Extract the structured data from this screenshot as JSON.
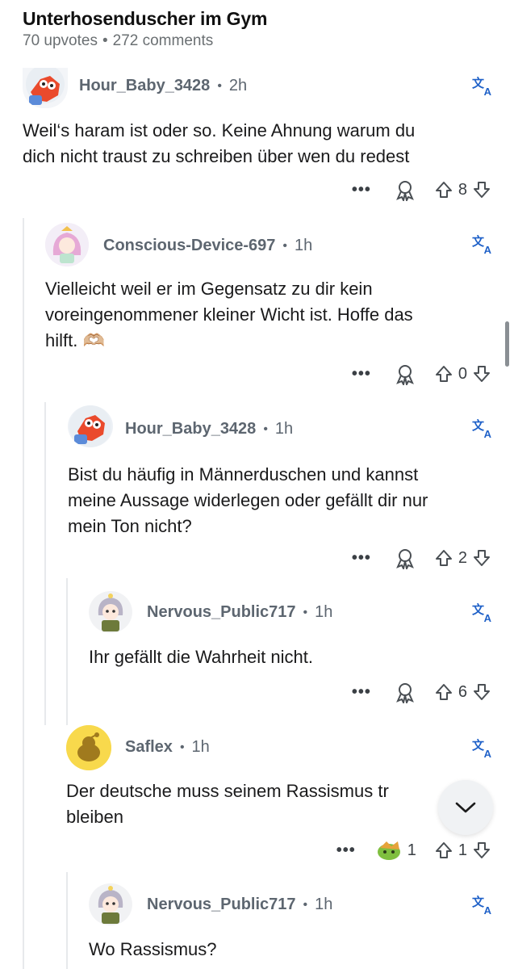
{
  "post": {
    "title": "Unterhosenduscher im Gym",
    "upvotes": "70 upvotes",
    "comments": "272 comments"
  },
  "comments": [
    {
      "username": "Hour_Baby_3428",
      "age": "2h",
      "text_lines": [
        "Weil‘s haram ist oder so. Keine Ahnung warum du",
        "dich nicht traust zu schreiben über wen du redest"
      ],
      "score": "8"
    },
    {
      "username": "Conscious-Device-697",
      "age": "1h",
      "text_lines": [
        "Vielleicht weil er im Gegensatz zu dir kein",
        "voreingenommener kleiner Wicht ist. Hoffe das",
        "hilft. 🫶🏼"
      ],
      "score": "0"
    },
    {
      "username": "Hour_Baby_3428",
      "age": "1h",
      "text_lines": [
        "Bist du häufig in Männerduschen und kannst",
        "meine Aussage widerlegen oder gefällt dir nur",
        "mein Ton nicht?"
      ],
      "score": "2"
    },
    {
      "username": "Nervous_Public717",
      "age": "1h",
      "text_lines": [
        "Ihr gefällt die Wahrheit nicht."
      ],
      "score": "6"
    },
    {
      "username": "Saflex",
      "age": "1h",
      "text_lines": [
        "Der deutsche muss seinem Rassismus tr",
        "bleiben"
      ],
      "award_count": "1",
      "score": "1"
    },
    {
      "username": "Nervous_Public717",
      "age": "1h",
      "text_lines": [
        "Wo Rassismus?"
      ]
    }
  ],
  "ui": {
    "more_label": "•••",
    "meta_separator": "•",
    "translate_icon": "translate-icon",
    "scroll_button_icon": "chevron-down-icon",
    "accent_color": "#1f61c8"
  }
}
